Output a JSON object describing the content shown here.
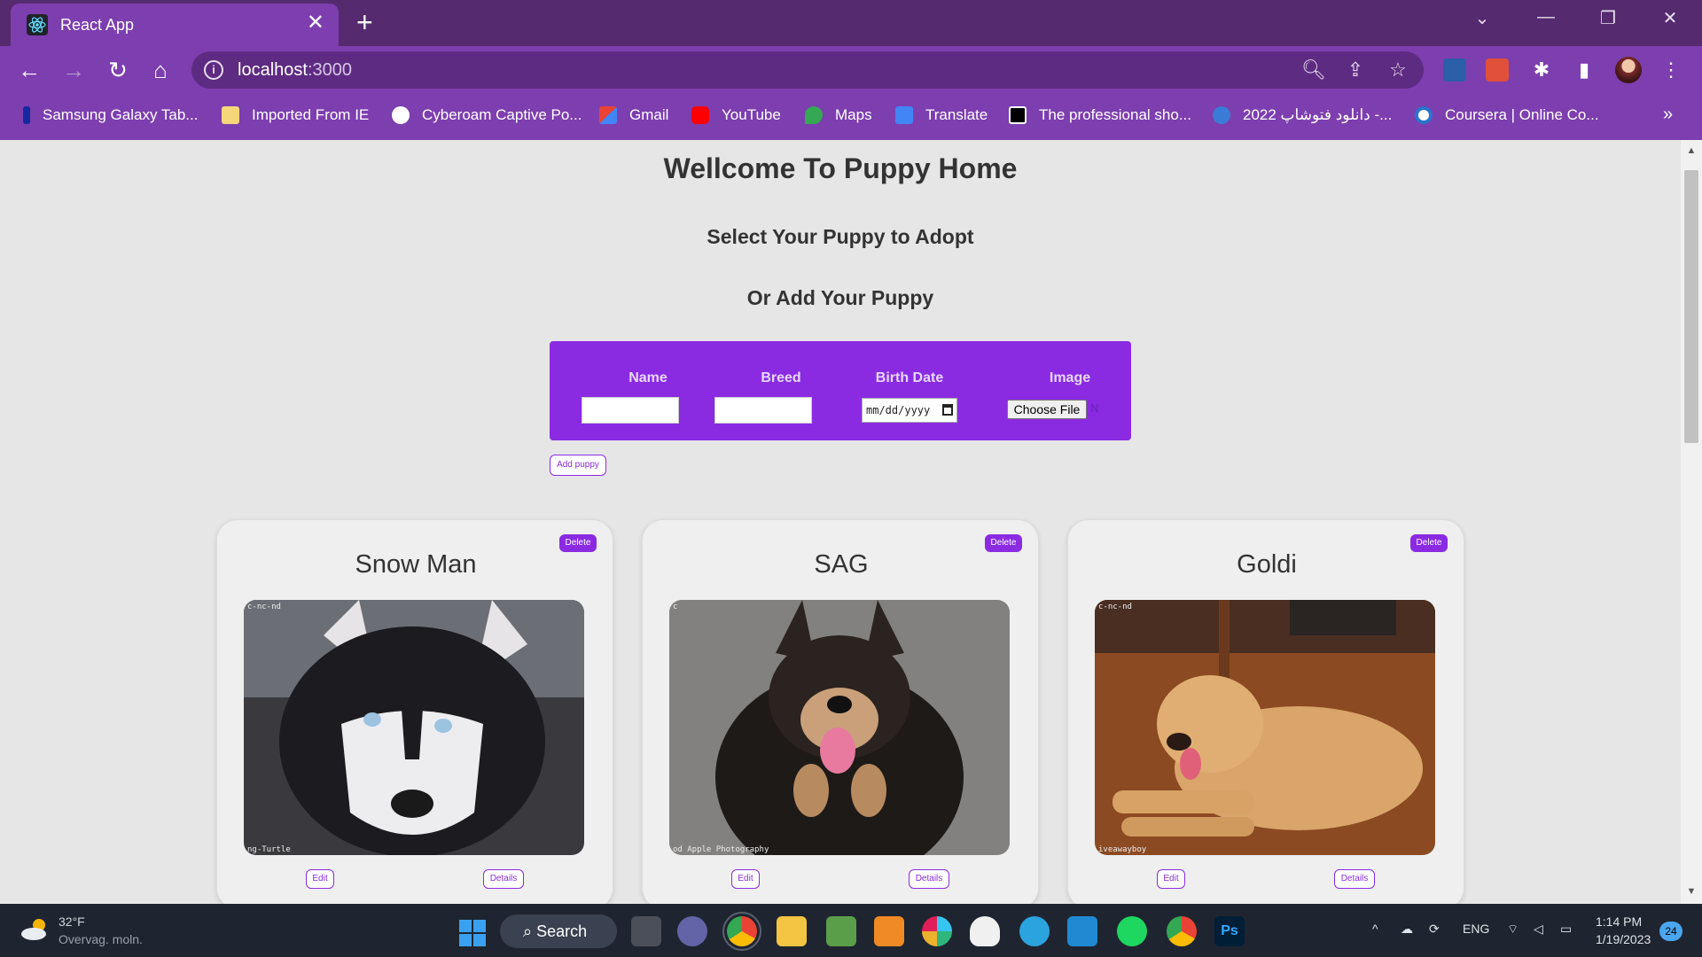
{
  "browser": {
    "tab_title": "React App",
    "url_host": "localhost",
    "url_port": ":3000",
    "bookmarks": [
      {
        "label": "Samsung Galaxy Tab...",
        "icon": "samsung-icon"
      },
      {
        "label": "Imported From IE",
        "icon": "folder-icon"
      },
      {
        "label": "Cyberoam Captive Po...",
        "icon": "globe-icon"
      },
      {
        "label": "Gmail",
        "icon": "gmail-icon"
      },
      {
        "label": "YouTube",
        "icon": "youtube-icon"
      },
      {
        "label": "Maps",
        "icon": "maps-icon"
      },
      {
        "label": "Translate",
        "icon": "translate-icon"
      },
      {
        "label": "The professional sho...",
        "icon": "g-icon"
      },
      {
        "label": "دانلود فتوشاپ 2022 -...",
        "icon": "photoshop-site-icon"
      },
      {
        "label": "Coursera | Online Co...",
        "icon": "coursera-icon"
      }
    ],
    "more_bookmarks": "»"
  },
  "page": {
    "title": "Wellcome To Puppy Home",
    "subtitle1": "Select Your Puppy to Adopt",
    "subtitle2": "Or Add Your Puppy",
    "form": {
      "name_label": "Name",
      "breed_label": "Breed",
      "birth_label": "Birth Date",
      "image_label": "Image",
      "date_placeholder": "mm/dd/yyyy",
      "file_button": "Choose File",
      "file_status": "N"
    },
    "add_button": "Add puppy",
    "cards": [
      {
        "name": "Snow Man",
        "delete": "Delete",
        "edit": "Edit",
        "details": "Details",
        "credit_top": "c-nc-nd",
        "credit_bottom": "ng-Turtle"
      },
      {
        "name": "SAG",
        "delete": "Delete",
        "edit": "Edit",
        "details": "Details",
        "credit_top": "c",
        "credit_bottom": "od Apple Photography"
      },
      {
        "name": "Goldi",
        "delete": "Delete",
        "edit": "Edit",
        "details": "Details",
        "credit_top": "c-nc-nd",
        "credit_bottom": "iveawayboy"
      }
    ]
  },
  "taskbar": {
    "weather_temp": "32°F",
    "weather_desc": "Overvag. moln.",
    "search_label": "Search",
    "lang": "ENG",
    "time": "1:14 PM",
    "date": "1/19/2023",
    "notifications": "24"
  },
  "colors": {
    "chrome_dark": "#552a6e",
    "chrome": "#7d3eb0",
    "accent": "#8a2be2"
  }
}
